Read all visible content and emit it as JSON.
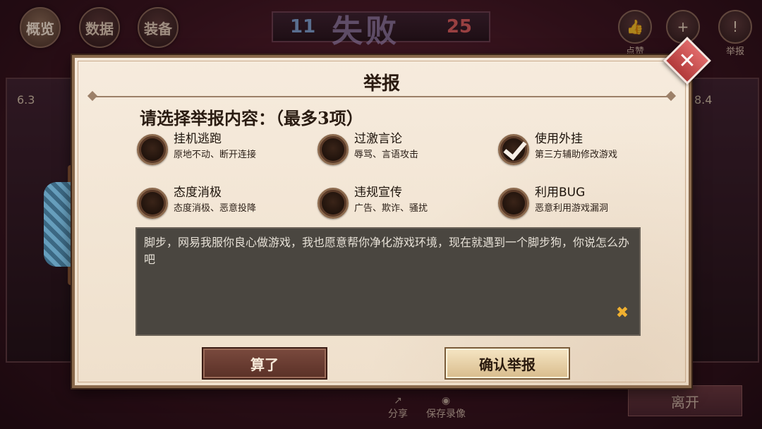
{
  "top_tabs": [
    "概览",
    "数据",
    "装备"
  ],
  "score": {
    "left": "11",
    "right": "25",
    "result": "失败"
  },
  "right_actions": [
    {
      "icon": "thumbs-up-icon",
      "label": "点赞"
    },
    {
      "icon": "add-friend-icon",
      "label": "加"
    },
    {
      "icon": "report-icon",
      "label": "举报"
    }
  ],
  "side_numbers": {
    "left": "6.3",
    "right": "8.4"
  },
  "bottom": {
    "share": "分享",
    "record": "保存录像",
    "leave": "离开"
  },
  "dialog": {
    "title": "举报",
    "prompt": "请选择举报内容：（最多3项）",
    "options": [
      {
        "title": "挂机逃跑",
        "desc": "原地不动、断开连接",
        "checked": false
      },
      {
        "title": "过激言论",
        "desc": "辱骂、言语攻击",
        "checked": false
      },
      {
        "title": "使用外挂",
        "desc": "第三方辅助修改游戏",
        "checked": true
      },
      {
        "title": "态度消极",
        "desc": "态度消极、恶意投降",
        "checked": false
      },
      {
        "title": "违规宣传",
        "desc": "广告、欺诈、骚扰",
        "checked": false
      },
      {
        "title": "利用BUG",
        "desc": "恶意利用游戏漏洞",
        "checked": false
      }
    ],
    "comment": "脚步，网易我服你良心做游戏，我也愿意帮你净化游戏环境，现在就遇到一个脚步狗，你说怎么办吧",
    "cancel_label": "算了",
    "confirm_label": "确认举报"
  }
}
